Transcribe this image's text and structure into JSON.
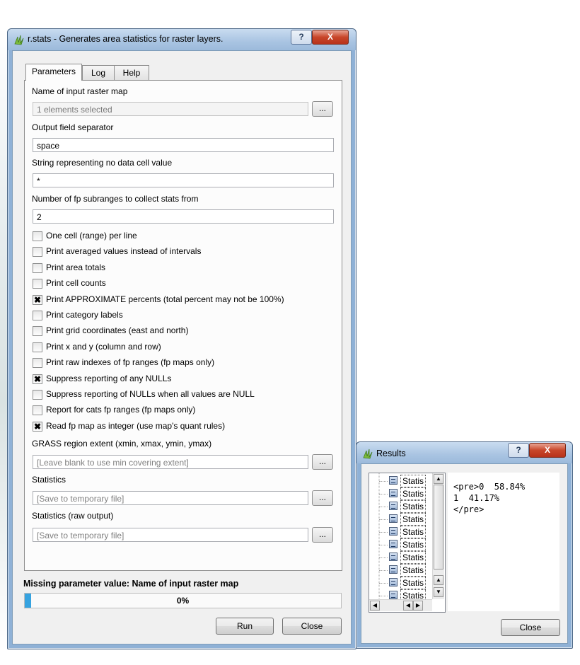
{
  "main_window": {
    "title": "r.stats - Generates area statistics for raster layers.",
    "help_btn": "?",
    "close_btn": "X",
    "tabs": [
      "Parameters",
      "Log",
      "Help"
    ],
    "fields": {
      "input_label": "Name of input raster map",
      "input_value": "1 elements selected",
      "separator_label": "Output field separator",
      "separator_value": "space",
      "nodata_label": "String representing no data cell value",
      "nodata_value": "*",
      "subranges_label": "Number of fp subranges to collect stats from",
      "subranges_value": "2",
      "region_label": "GRASS region extent (xmin, xmax, ymin, ymax)",
      "region_placeholder": "[Leave blank to use min covering extent]",
      "stats_label": "Statistics",
      "stats_placeholder": "[Save to temporary file]",
      "raw_label": "Statistics (raw output)",
      "raw_placeholder": "[Save to temporary file]",
      "browse": "..."
    },
    "checkboxes": [
      {
        "label": "One cell (range) per line",
        "checked": false
      },
      {
        "label": "Print averaged values instead of intervals",
        "checked": false
      },
      {
        "label": "Print area totals",
        "checked": false
      },
      {
        "label": "Print cell counts",
        "checked": false
      },
      {
        "label": "Print APPROXIMATE percents (total percent may not be 100%)",
        "checked": true
      },
      {
        "label": "Print category labels",
        "checked": false
      },
      {
        "label": "Print grid coordinates (east and north)",
        "checked": false
      },
      {
        "label": "Print x and y (column and row)",
        "checked": false
      },
      {
        "label": "Print raw indexes of fp ranges (fp maps only)",
        "checked": false
      },
      {
        "label": "Suppress reporting of any NULLs",
        "checked": true
      },
      {
        "label": "Suppress reporting of NULLs when all values are NULL",
        "checked": false
      },
      {
        "label": "Report for cats fp ranges (fp maps only)",
        "checked": false
      },
      {
        "label": "Read fp map as integer (use map's quant rules)",
        "checked": true
      }
    ],
    "check_mark": "✖",
    "status": "Missing parameter value: Name of input raster map",
    "progress": {
      "value": 0,
      "label": "0%"
    },
    "run_btn": "Run",
    "close_button": "Close"
  },
  "results_window": {
    "title": "Results",
    "help_btn": "?",
    "close_btn": "X",
    "items": [
      "Statis",
      "Statis",
      "Statis",
      "Statis",
      "Statis",
      "Statis",
      "Statis",
      "Statis",
      "Statis",
      "Statis"
    ],
    "output": "<pre>0  58.84%\n1  41.17%\n</pre>",
    "close_button": "Close",
    "arrows": {
      "up": "▲",
      "down": "▼",
      "left": "◀",
      "right": "▶"
    }
  },
  "colors": {
    "accent": "#36a3e0",
    "title_bar": "#a9c4e2",
    "close_red": "#c8462a"
  }
}
